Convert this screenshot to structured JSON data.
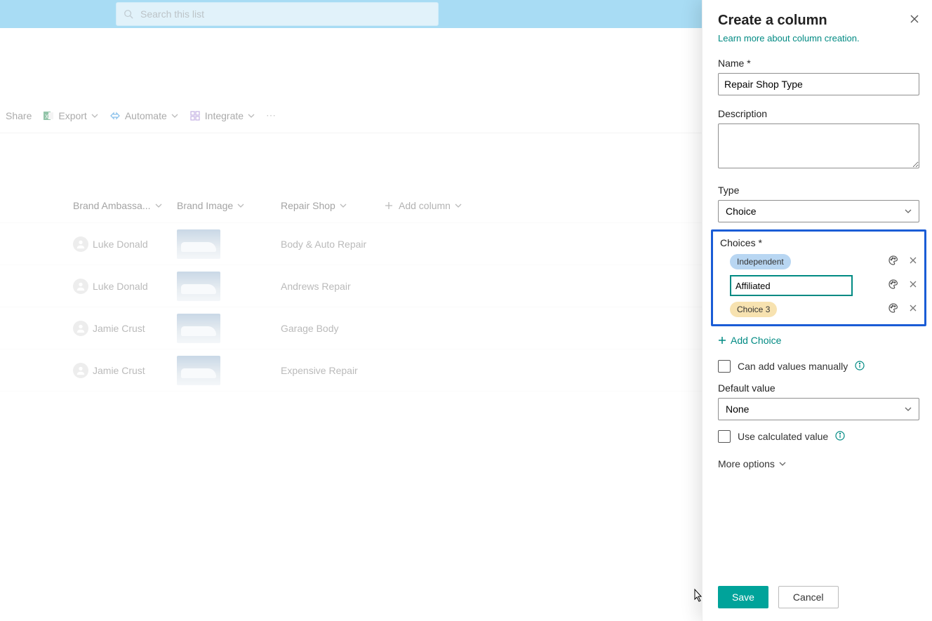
{
  "search": {
    "placeholder": "Search this list"
  },
  "toolbar": {
    "share": "Share",
    "export": "Export",
    "automate": "Automate",
    "integrate": "Integrate"
  },
  "columns": {
    "ambassador": "Brand Ambassa...",
    "image": "Brand Image",
    "repair": "Repair Shop",
    "add": "Add column"
  },
  "rows": [
    {
      "person": "Luke Donald",
      "repair": "Body & Auto Repair"
    },
    {
      "person": "Luke Donald",
      "repair": "Andrews Repair"
    },
    {
      "person": "Jamie Crust",
      "repair": "Garage Body"
    },
    {
      "person": "Jamie Crust",
      "repair": "Expensive Repair"
    }
  ],
  "panel": {
    "title": "Create a column",
    "learn_link": "Learn more about column creation.",
    "name_label": "Name *",
    "name_value": "Repair Shop Type",
    "desc_label": "Description",
    "type_label": "Type",
    "type_value": "Choice",
    "choices_label": "Choices *",
    "choice1": "Independent",
    "choice2_value": "Affiliated",
    "choice3": "Choice 3",
    "add_choice": "Add Choice",
    "manual_label": "Can add values manually",
    "default_label": "Default value",
    "default_value": "None",
    "calc_label": "Use calculated value",
    "more": "More options",
    "save": "Save",
    "cancel": "Cancel"
  }
}
